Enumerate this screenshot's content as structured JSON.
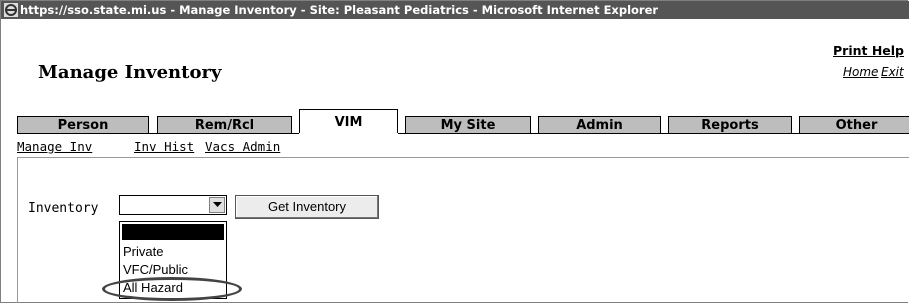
{
  "window": {
    "title": "https://sso.state.mi.us - Manage Inventory - Site: Pleasant Pediatrics - Microsoft Internet Explorer"
  },
  "header": {
    "page_title": "Manage Inventory",
    "print_help": "Print Help",
    "home": "Home",
    "exit": "Exit"
  },
  "tabs": [
    {
      "label": "Person"
    },
    {
      "label": "Rem/Rcl"
    },
    {
      "label": "VIM",
      "active": true
    },
    {
      "label": "My Site"
    },
    {
      "label": "Admin"
    },
    {
      "label": "Reports"
    },
    {
      "label": "Other"
    }
  ],
  "subnav": [
    "Manage Inv",
    "Inv Hist",
    "Vacs Admin"
  ],
  "form": {
    "inventory_label": "Inventory",
    "inventory_value": "",
    "get_button": "Get Inventory"
  },
  "dropdown": {
    "options": [
      "",
      "Private",
      "VFC/Public",
      "All Hazard"
    ],
    "highlighted_index": 0,
    "circled_option": "All Hazard"
  }
}
